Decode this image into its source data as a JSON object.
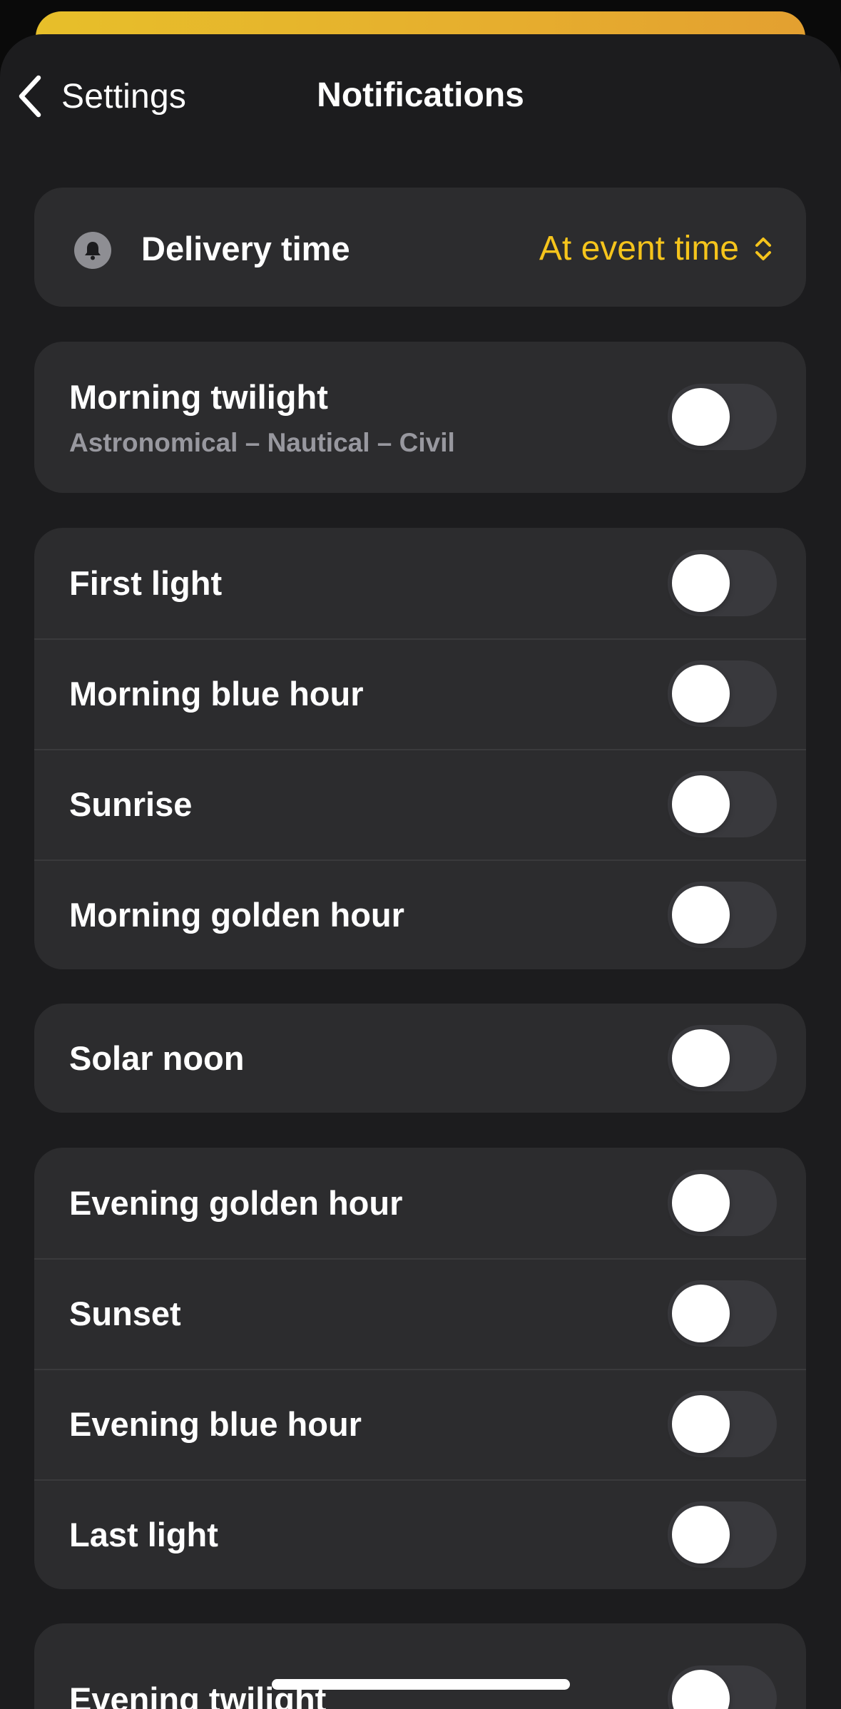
{
  "nav": {
    "back_label": "Settings",
    "title": "Notifications"
  },
  "delivery": {
    "icon": "bell-icon",
    "label": "Delivery time",
    "value": "At event time",
    "value_color": "#f5c41c"
  },
  "groups": [
    {
      "items": [
        {
          "label": "Morning twilight",
          "sublabel": "Astronomical – Nautical – Civil",
          "enabled": false
        }
      ]
    },
    {
      "items": [
        {
          "label": "First light",
          "enabled": false
        },
        {
          "label": "Morning blue hour",
          "enabled": false
        },
        {
          "label": "Sunrise",
          "enabled": false
        },
        {
          "label": "Morning golden hour",
          "enabled": false
        }
      ]
    },
    {
      "items": [
        {
          "label": "Solar noon",
          "enabled": false
        }
      ]
    },
    {
      "items": [
        {
          "label": "Evening golden hour",
          "enabled": false
        },
        {
          "label": "Sunset",
          "enabled": false
        },
        {
          "label": "Evening blue hour",
          "enabled": false
        },
        {
          "label": "Last light",
          "enabled": false
        }
      ]
    },
    {
      "items": [
        {
          "label": "Evening twilight",
          "enabled": false
        }
      ]
    }
  ],
  "colors": {
    "background": "#1c1c1e",
    "card": "#2c2c2e",
    "accent": "#f5c41c",
    "toggle_off": "#39393d"
  }
}
